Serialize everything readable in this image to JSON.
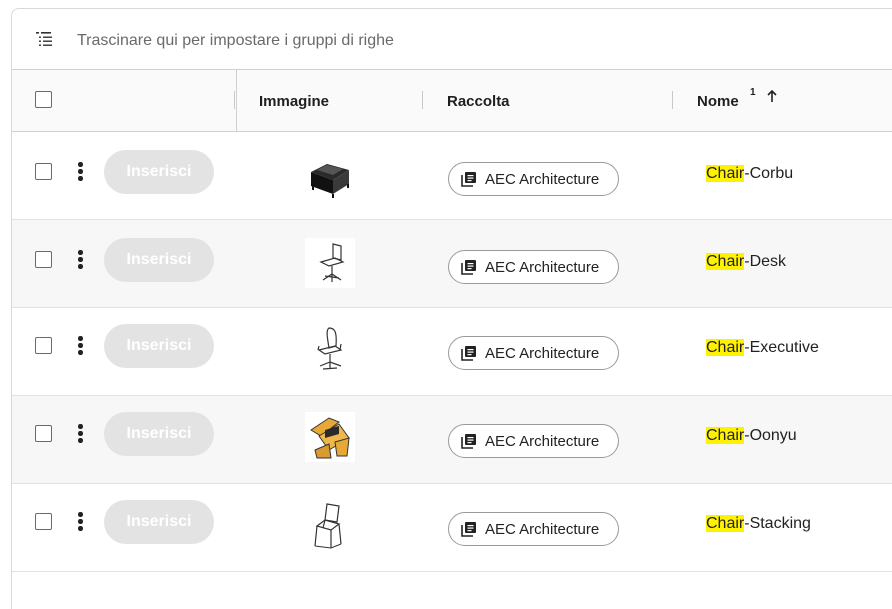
{
  "group_bar": {
    "icon": "group-rows-icon",
    "placeholder": "Trascinare qui per impostare i gruppi di righe"
  },
  "columns": {
    "image": "Immagine",
    "collection": "Raccolta",
    "name": "Nome",
    "name_sort_index": "1",
    "name_sort_direction": "ascending"
  },
  "highlight_term": "Chair",
  "rows": [
    {
      "insert_label": "Inserisci",
      "thumbnail": "chair-corbu-thumbnail",
      "collection": "AEC Architecture",
      "name_match": "Chair",
      "name_rest": "-Corbu"
    },
    {
      "insert_label": "Inserisci",
      "thumbnail": "chair-desk-thumbnail",
      "collection": "AEC Architecture",
      "name_match": "Chair",
      "name_rest": "-Desk"
    },
    {
      "insert_label": "Inserisci",
      "thumbnail": "chair-executive-thumbnail",
      "collection": "AEC Architecture",
      "name_match": "Chair",
      "name_rest": "-Executive"
    },
    {
      "insert_label": "Inserisci",
      "thumbnail": "chair-oonyu-thumbnail",
      "collection": "AEC Architecture",
      "name_match": "Chair",
      "name_rest": "-Oonyu"
    },
    {
      "insert_label": "Inserisci",
      "thumbnail": "chair-stacking-thumbnail",
      "collection": "AEC Architecture",
      "name_match": "Chair",
      "name_rest": "-Stacking"
    }
  ],
  "colors": {
    "highlight": "#fff200",
    "insert_button_bg": "#e3e3e3",
    "row_alt_bg": "#f7f7f7"
  }
}
